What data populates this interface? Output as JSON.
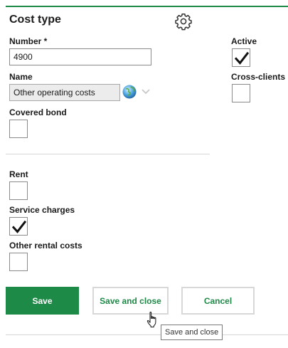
{
  "dialog": {
    "title": "Cost type",
    "settings_icon": "gear-icon"
  },
  "fields": {
    "number": {
      "label": "Number *",
      "value": "4900"
    },
    "name": {
      "label": "Name",
      "value": "Other operating costs",
      "language_icon": "globe-icon",
      "dropdown_icon": "chevron-down-icon"
    },
    "covered_bond": {
      "label": "Covered bond",
      "checked": false
    },
    "active": {
      "label": "Active",
      "checked": true
    },
    "cross_clients": {
      "label": "Cross-clients",
      "checked": false
    },
    "rent": {
      "label": "Rent",
      "checked": false
    },
    "service_charges": {
      "label": "Service charges",
      "checked": true
    },
    "other_rental_costs": {
      "label": "Other rental costs",
      "checked": false
    }
  },
  "buttons": {
    "save": "Save",
    "save_and_close": "Save and close",
    "cancel": "Cancel"
  },
  "tooltip": {
    "text": "Save and close"
  },
  "colors": {
    "accent": "#1e8a47",
    "border": "#8a8a8a",
    "readonly_bg": "#ececec"
  }
}
